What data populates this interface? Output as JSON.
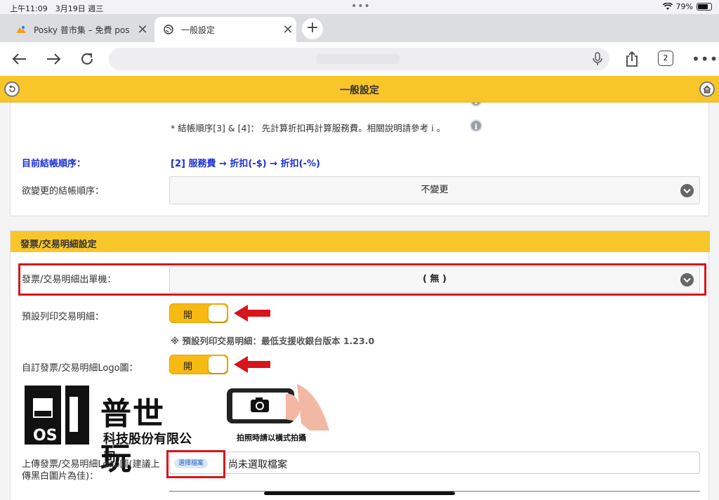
{
  "status_bar": {
    "time": "上午11:09　3月19日 週三",
    "battery": "79%",
    "battery_level": 0.79
  },
  "browser": {
    "tabs": [
      {
        "title": "Posky 普市集 – 免費 pos",
        "active": false
      },
      {
        "title": "一般設定",
        "active": true
      }
    ],
    "tab_count": "2"
  },
  "app": {
    "title": "一般設定"
  },
  "checkout": {
    "note": "* 結帳順序[3] & [4]： 先計算折扣再計算服務費。相關說明請參考 i 。",
    "current_order_label": "目前結帳順序：",
    "current_order_value": "[2] 服務費 → 折扣(-$) → 折扣(-%)",
    "change_order_label": "欲變更的結帳順序：",
    "change_order_value": "不變更"
  },
  "invoice_section": {
    "header": "發票/交易明細設定",
    "printer_label": "發票/交易明細出單機：",
    "printer_value": "( 無 )",
    "default_print_label": "預設列印交易明細：",
    "default_print_toggle": "開",
    "default_print_hint": "※ 預設列印交易明細：最低支援收銀台版本 1.23.0",
    "custom_logo_label": "自訂發票/交易明細Logo圖：",
    "custom_logo_toggle": "開",
    "logo_text_main": "普世玩",
    "logo_text_sub": "科技股份有限公司",
    "photo_tip": "拍照時請以橫式拍攝",
    "upload_label": "上傳發票/交易明細Logo圖(建議上傳黑白圖片為佳)：",
    "choose_file": "選擇檔案",
    "no_file": "尚未選取檔案"
  },
  "colors": {
    "header_yellow": "#f9c62a",
    "toggle_on": "#f7b913",
    "highlight_red": "#d8151c",
    "link_blue": "#1a2fd6"
  }
}
